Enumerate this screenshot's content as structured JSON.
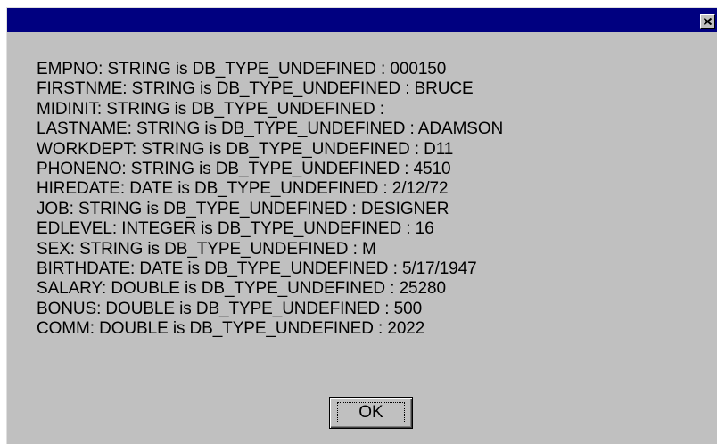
{
  "dialog": {
    "title": "",
    "close_glyph": "✕",
    "lines": [
      "EMPNO: STRING is DB_TYPE_UNDEFINED : 000150",
      "FIRSTNME: STRING is DB_TYPE_UNDEFINED : BRUCE",
      "MIDINIT: STRING is DB_TYPE_UNDEFINED :",
      "LASTNAME: STRING is DB_TYPE_UNDEFINED : ADAMSON",
      "WORKDEPT: STRING is DB_TYPE_UNDEFINED : D11",
      "PHONENO: STRING is DB_TYPE_UNDEFINED : 4510",
      "HIREDATE: DATE is DB_TYPE_UNDEFINED : 2/12/72",
      "JOB: STRING is DB_TYPE_UNDEFINED : DESIGNER",
      "EDLEVEL: INTEGER is DB_TYPE_UNDEFINED : 16",
      "SEX: STRING is DB_TYPE_UNDEFINED : M",
      "BIRTHDATE: DATE is DB_TYPE_UNDEFINED : 5/17/1947",
      "SALARY: DOUBLE is DB_TYPE_UNDEFINED : 25280",
      "BONUS: DOUBLE is DB_TYPE_UNDEFINED : 500",
      "COMM: DOUBLE is DB_TYPE_UNDEFINED : 2022"
    ],
    "ok_label": "OK"
  },
  "colors": {
    "titlebar": "#000080",
    "face": "#c0c0c0",
    "text": "#000000"
  },
  "icons": {
    "close": "close-icon"
  }
}
